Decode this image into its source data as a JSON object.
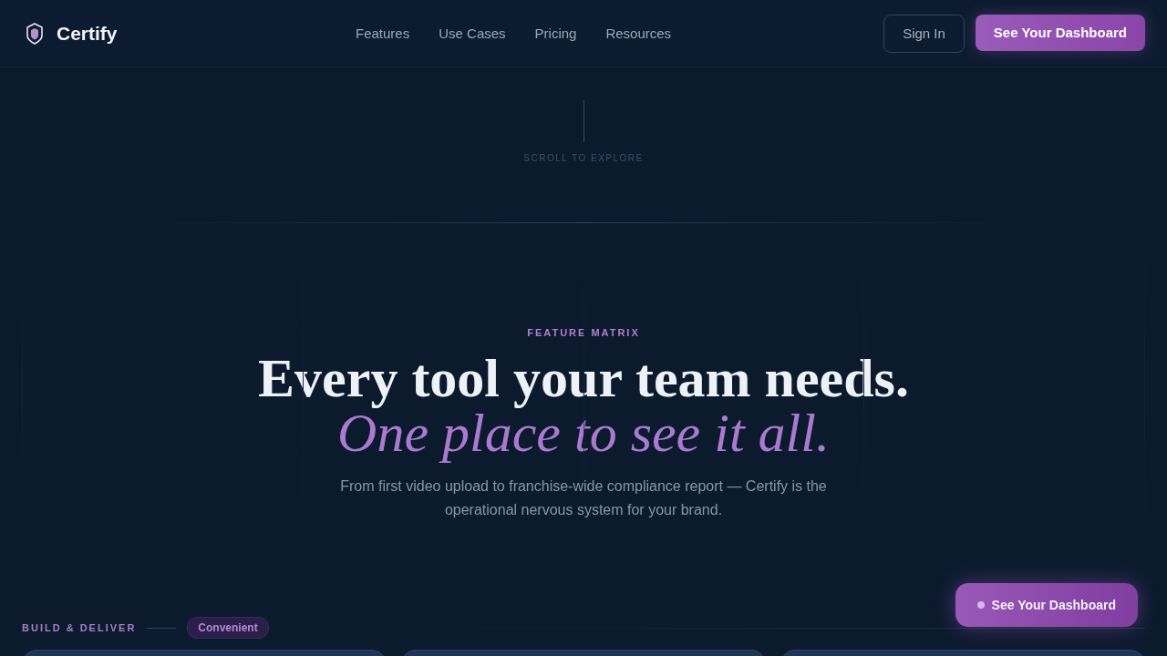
{
  "nav": {
    "brand": "Certify",
    "links": [
      "Features",
      "Use Cases",
      "Pricing",
      "Resources"
    ],
    "sign_in": "Sign In",
    "cta": "See Your Dashboard"
  },
  "scroll_hint": "SCROLL TO EXPLORE",
  "hero": {
    "eyebrow": "FEATURE MATRIX",
    "title": "Every tool your team needs.",
    "title_accent": "One place to see it all.",
    "subtitle": "From first video upload to franchise-wide compliance report — Certify is the operational nervous system for your brand."
  },
  "section": {
    "label": "BUILD & DELIVER",
    "badge": "Convenient",
    "cards": [
      {
        "kind": "card"
      },
      {
        "kind": "card"
      },
      {
        "kind": "card"
      }
    ]
  },
  "floating_button": {
    "label": "See Your Dashboard"
  }
}
